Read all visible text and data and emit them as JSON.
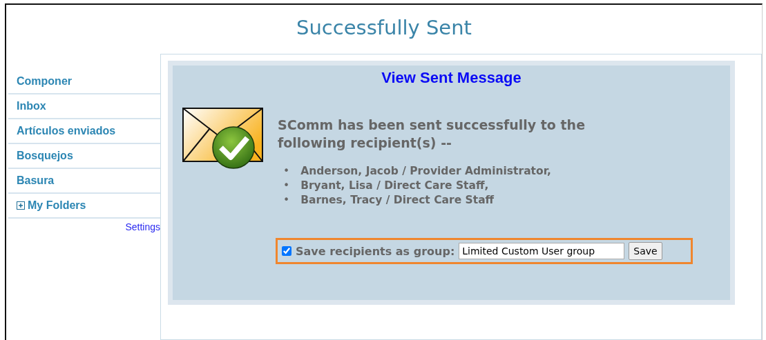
{
  "page_title": "Successfully Sent",
  "sidebar": {
    "items": [
      {
        "kind": "link",
        "label": "Componer"
      },
      {
        "kind": "link",
        "label": "Inbox"
      },
      {
        "kind": "link",
        "label": "Artículos enviados"
      },
      {
        "kind": "link",
        "label": "Bosquejos"
      },
      {
        "kind": "link",
        "label": "Basura"
      },
      {
        "kind": "folder",
        "label": "My Folders",
        "expanded": false
      }
    ],
    "settings_link": "Settings"
  },
  "panel": {
    "title": "View Sent Message",
    "message": "SComm has been sent successfully to the following recipient(s) --",
    "recipients": [
      {
        "bullet": "•",
        "text": "Anderson, Jacob / Provider Administrator,"
      },
      {
        "bullet": "•",
        "text": "Bryant, Lisa / Direct Care Staff,"
      },
      {
        "bullet": "•",
        "text": "Barnes, Tracy / Direct Care Staff"
      }
    ],
    "save_group": {
      "checked": true,
      "label": "Save recipients as group:",
      "value": "Limited Custom User group",
      "button": "Save"
    }
  }
}
